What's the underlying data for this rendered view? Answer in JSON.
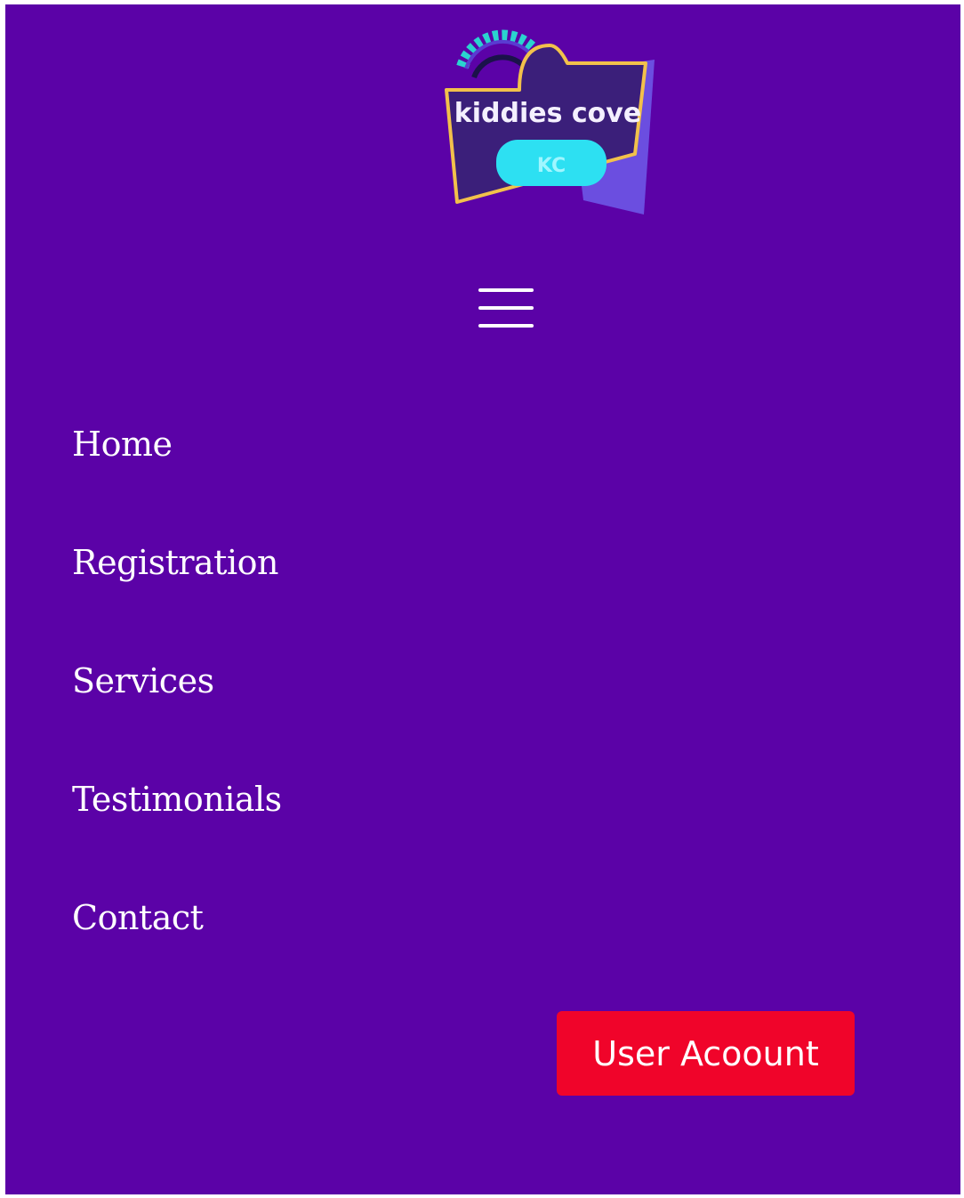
{
  "logo": {
    "name": "kiddies cove",
    "badge": "KC"
  },
  "header": {
    "menu_icon": "hamburger-icon"
  },
  "nav": {
    "items": [
      {
        "label": "Home"
      },
      {
        "label": "Registration"
      },
      {
        "label": "Services"
      },
      {
        "label": "Testimonials"
      },
      {
        "label": "Contact"
      }
    ]
  },
  "account": {
    "label": "User Acoount"
  },
  "colors": {
    "background": "#5b02a7",
    "button": "#f0042a",
    "logo_badge": "#2de0f2",
    "logo_body": "#3b1f7a",
    "logo_border": "#f2c14b"
  }
}
